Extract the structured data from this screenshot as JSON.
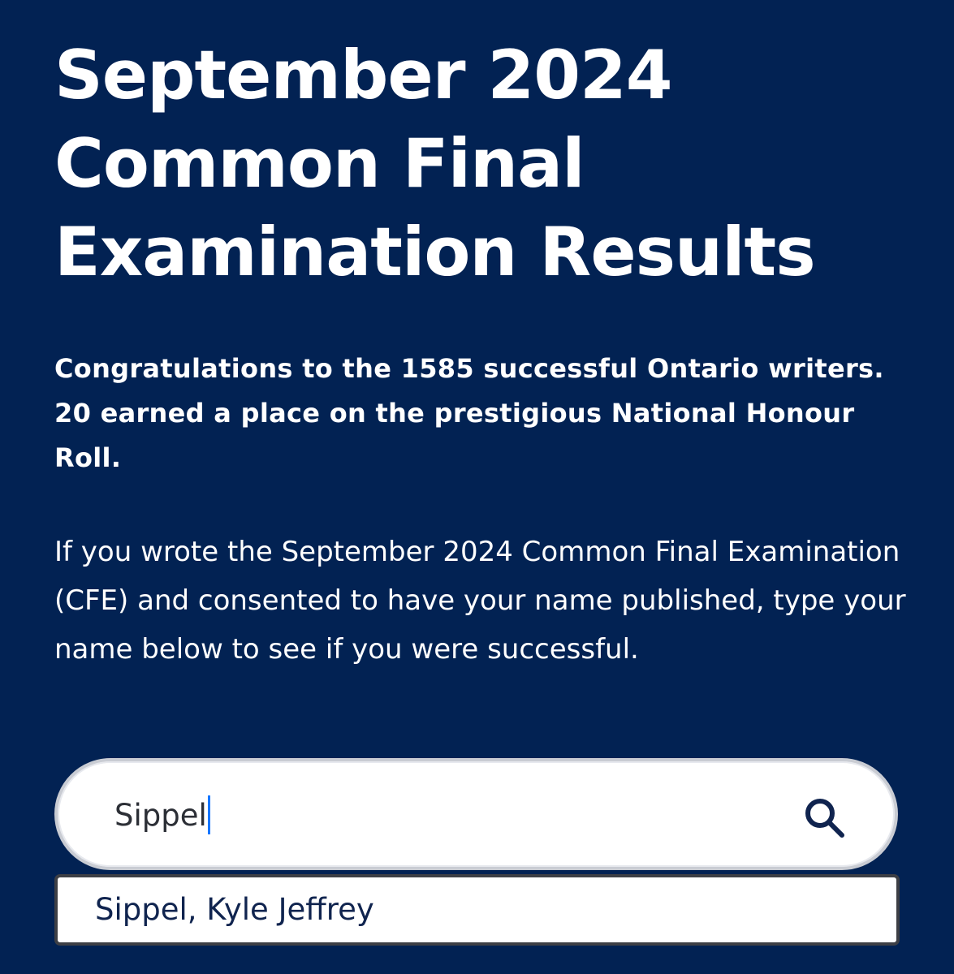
{
  "page": {
    "title": "September 2024 Common Final Examination Results",
    "lead": "Congratulations to the 1585 successful Ontario writers. 20 earned a place on the prestigious National Honour Roll.",
    "instructions": "If you wrote the September 2024 Common Final Examination (CFE) and consented to have your name published, type your name below to see if you were successful."
  },
  "search": {
    "value": "Sippel",
    "icon": "search-icon"
  },
  "autocomplete": {
    "options": [
      "Sippel, Kyle Jeffrey"
    ]
  },
  "colors": {
    "background": "#022253",
    "text": "#ffffff",
    "input_text": "#2c2f36",
    "caret": "#1677ff",
    "icon": "#10244f"
  }
}
